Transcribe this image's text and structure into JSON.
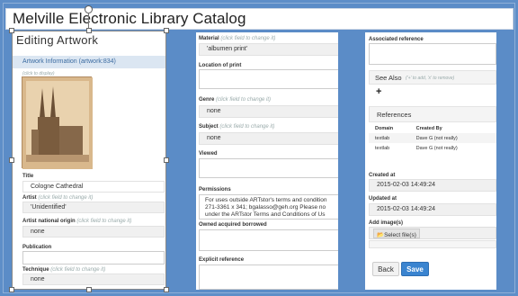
{
  "window": {
    "title": "Melville Electronic Library Catalog"
  },
  "editor": {
    "heading": "Editing Artwork",
    "section": "Artwork Information (artwork:834)",
    "click_to_display": "(click to display)",
    "fields": {
      "title": {
        "label": "Title",
        "value": "Cologne Cathedral"
      },
      "artist": {
        "label": "Artist",
        "hint": "(click field to change it)",
        "value": "'Unidentified'"
      },
      "artist_origin": {
        "label": "Artist national origin",
        "hint": "(click field to change it)",
        "value": "none"
      },
      "publication": {
        "label": "Publication"
      },
      "technique": {
        "label": "Technique",
        "hint": "(click field to change it)",
        "value": "none"
      },
      "material": {
        "label": "Material",
        "hint": "(click field to change it)",
        "value": "'albumen print'"
      },
      "location": {
        "label": "Location of print"
      },
      "genre": {
        "label": "Genre",
        "hint": "(click field to change it)",
        "value": "none"
      },
      "subject": {
        "label": "Subject",
        "hint": "(click field to change it)",
        "value": "none"
      },
      "viewed": {
        "label": "Viewed"
      },
      "permissions": {
        "label": "Permissions",
        "text": "For uses outside ARTstor's terms and condition 271-3361 x 341; bgalasso@geh.org  Please no under the ARTstor Terms and Conditions of Us"
      },
      "owned": {
        "label": "Owned acquired borrowed"
      },
      "explicit": {
        "label": "Explicit reference"
      },
      "associated": {
        "label": "Associated reference"
      },
      "see_also": {
        "label": "See Also",
        "hint": "('+' to add, 'x' to remove)",
        "add": "+"
      },
      "references": {
        "label": "References",
        "headers": [
          "Domain",
          "Created By"
        ],
        "rows": [
          [
            "textlab",
            "Dave G (not really)"
          ],
          [
            "textlab",
            "Dave G (not really)"
          ]
        ]
      },
      "created": {
        "label": "Created at",
        "value": "2015-02-03 14:49:24"
      },
      "updated": {
        "label": "Updated at",
        "value": "2015-02-03 14:49:24"
      },
      "images": {
        "label": "Add image(s)",
        "button": "Select file(s)"
      }
    },
    "buttons": {
      "back": "Back",
      "save": "Save"
    }
  },
  "colors": {
    "accent": "#3a84d0",
    "background": "#5b8cc7",
    "section": "#dbe6f2"
  }
}
